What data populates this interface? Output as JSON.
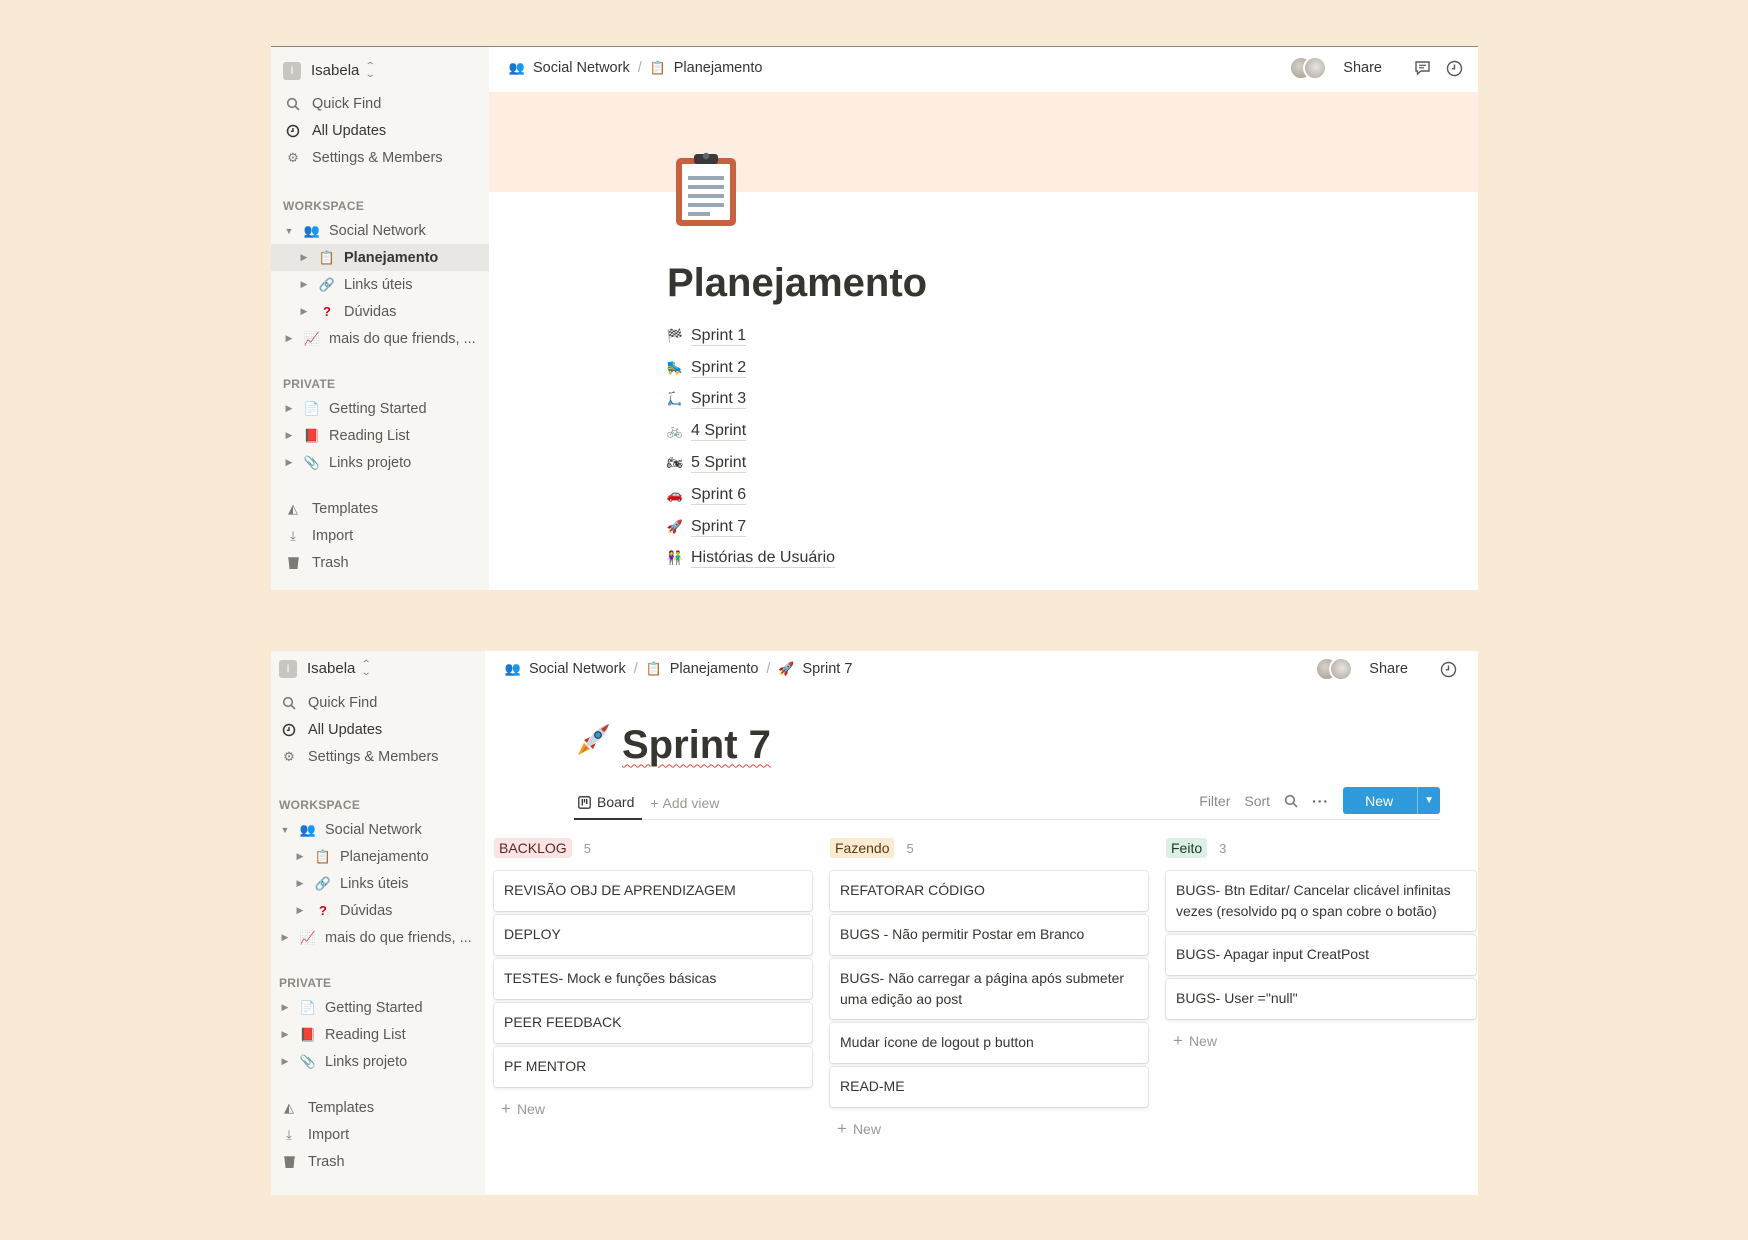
{
  "sidebar": {
    "user_initial": "I",
    "user_name": "Isabela",
    "quick_find": "Quick Find",
    "all_updates": "All Updates",
    "settings": "Settings & Members",
    "workspace_label": "WORKSPACE",
    "workspace_root": "Social Network",
    "workspace_children": [
      "Planejamento",
      "Links úteis",
      "Dúvidas"
    ],
    "workspace_other": "mais do que friends, ...",
    "private_label": "PRIVATE",
    "private_items": [
      "Getting Started",
      "Reading List",
      "Links projeto"
    ],
    "templates": "Templates",
    "import": "Import",
    "trash": "Trash"
  },
  "page1": {
    "breadcrumb": [
      "Social Network",
      "Planejamento"
    ],
    "share": "Share",
    "title": "Planejamento",
    "subpages": [
      {
        "icon": "checkered-flag-icon",
        "label": "Sprint 1"
      },
      {
        "icon": "roller-skate-icon",
        "label": "Sprint 2"
      },
      {
        "icon": "scooter-icon",
        "label": "Sprint 3"
      },
      {
        "icon": "bicycle-icon",
        "label": "4 Sprint"
      },
      {
        "icon": "motorcycle-icon",
        "label": "5 Sprint"
      },
      {
        "icon": "car-icon",
        "label": "Sprint 6"
      },
      {
        "icon": "rocket-icon",
        "label": "Sprint 7"
      },
      {
        "icon": "people-icon",
        "label": "Histórias de Usuário"
      }
    ]
  },
  "page2": {
    "breadcrumb": [
      "Social Network",
      "Planejamento",
      "Sprint 7"
    ],
    "share": "Share",
    "title": "Sprint 7",
    "view_tab": "Board",
    "add_view": "Add view",
    "filter": "Filter",
    "sort": "Sort",
    "new_button": "New",
    "columns": [
      {
        "name": "BACKLOG",
        "count": "5",
        "bg": "#fbe4e4",
        "fg": "#5c2826",
        "cards": [
          "REVISÃO OBJ DE APRENDIZAGEM",
          "DEPLOY",
          "TESTES- Mock e funções básicas",
          "PEER FEEDBACK",
          "PF MENTOR"
        ]
      },
      {
        "name": "Fazendo",
        "count": "5",
        "bg": "#fbebd2",
        "fg": "#5a3a10",
        "cards": [
          "REFATORAR CÓDIGO",
          "BUGS - Não permitir Postar em Branco",
          "BUGS- Não carregar a página após submeter uma edição ao post",
          "Mudar ícone de logout p button",
          "READ-ME"
        ]
      },
      {
        "name": "Feito",
        "count": "3",
        "bg": "#ddefe3",
        "fg": "#1c3829",
        "cards": [
          "BUGS- Btn Editar/ Cancelar clicável infinitas vezes (resolvido pq o span cobre o botão)",
          "BUGS- Apagar input CreatPost",
          "BUGS- User =\"null\""
        ]
      }
    ],
    "add_new": "New"
  },
  "colors": {
    "background": "#f9ead6",
    "sidebar": "#f7f6f3",
    "accent_blue": "#2f9bdc",
    "cover": "#fdeee1"
  }
}
